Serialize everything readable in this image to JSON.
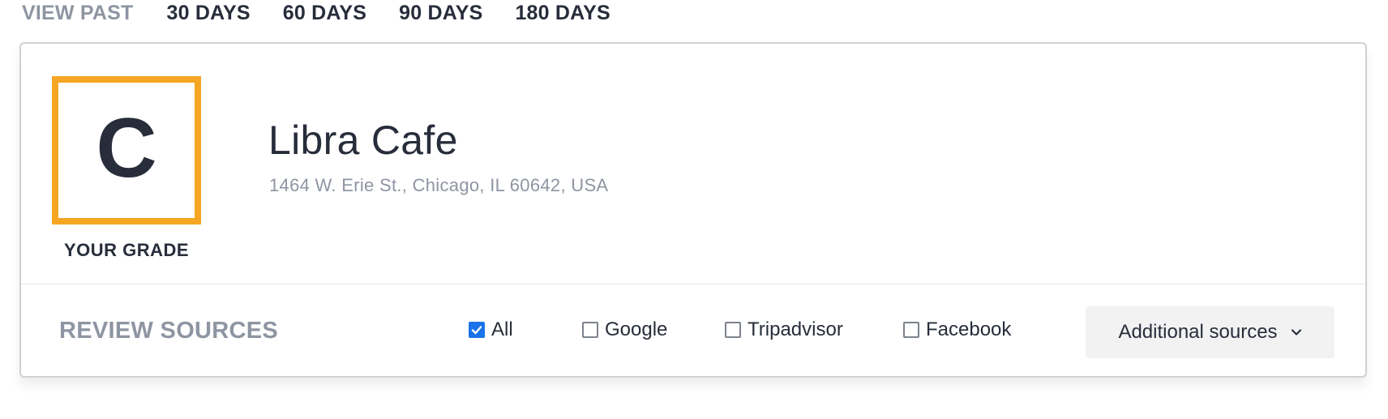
{
  "view_past": {
    "label": "VIEW PAST",
    "options": [
      "30 DAYS",
      "60 DAYS",
      "90 DAYS",
      "180 DAYS"
    ]
  },
  "grade": {
    "letter": "C",
    "label": "YOUR GRADE",
    "color": "#f5a623"
  },
  "business": {
    "name": "Libra Cafe",
    "address": "1464 W. Erie St., Chicago, IL 60642, USA"
  },
  "review_sources": {
    "label": "REVIEW SOURCES",
    "items": [
      {
        "label": "All",
        "checked": true
      },
      {
        "label": "Google",
        "checked": false
      },
      {
        "label": "Tripadvisor",
        "checked": false
      },
      {
        "label": "Facebook",
        "checked": false
      }
    ],
    "additional_label": "Additional sources",
    "additional_icon": "chevron-down-icon"
  },
  "colors": {
    "accent": "#1a73e8",
    "text_dark": "#272d3a",
    "text_muted": "#8e95a2"
  }
}
